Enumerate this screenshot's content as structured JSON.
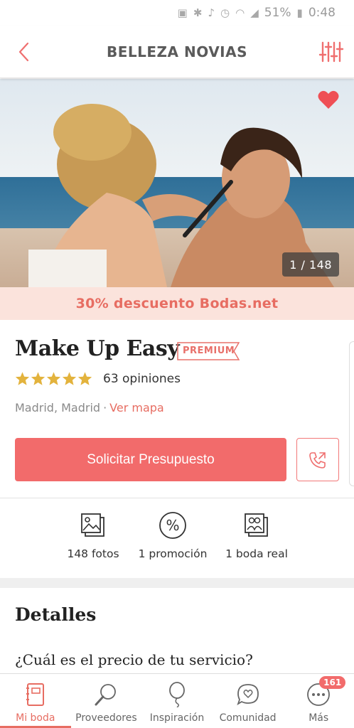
{
  "status_bar": {
    "battery": "51%",
    "time": "0:48"
  },
  "header": {
    "title": "BELLEZA NOVIAS",
    "back_icon": "chevron-left-icon",
    "filter_icon": "sliders-icon"
  },
  "gallery": {
    "counter": "1 / 148",
    "favorite_icon": "heart-icon"
  },
  "promo": {
    "text": "30% descuento Bodas.net"
  },
  "vendor": {
    "name": "Make Up Easy",
    "badge": "PREMIUM",
    "rating": 5,
    "reviews": "63 opiniones",
    "location": "Madrid, Madrid",
    "separator": "·",
    "map_link": "Ver mapa"
  },
  "actions": {
    "quote_label": "Solicitar Presupuesto",
    "call_icon": "phone-icon"
  },
  "stats": [
    {
      "icon": "photos-icon",
      "label": "148 fotos"
    },
    {
      "icon": "percent-icon",
      "label": "1 promoción"
    },
    {
      "icon": "couple-photo-icon",
      "label": "1 boda real"
    }
  ],
  "details": {
    "title": "Detalles",
    "question": "¿Cuál es el precio de tu servicio?"
  },
  "bottom_nav": [
    {
      "label": "Mi boda",
      "icon": "notebook-icon",
      "active": true
    },
    {
      "label": "Proveedores",
      "icon": "magnifier-icon"
    },
    {
      "label": "Inspiración",
      "icon": "balloon-icon"
    },
    {
      "label": "Comunidad",
      "icon": "chat-heart-icon"
    },
    {
      "label": "Más",
      "icon": "more-icon",
      "badge": "161"
    }
  ],
  "colors": {
    "accent": "#f26b6b",
    "promo_bg": "#fbe3dc",
    "star": "#e3b33d"
  }
}
